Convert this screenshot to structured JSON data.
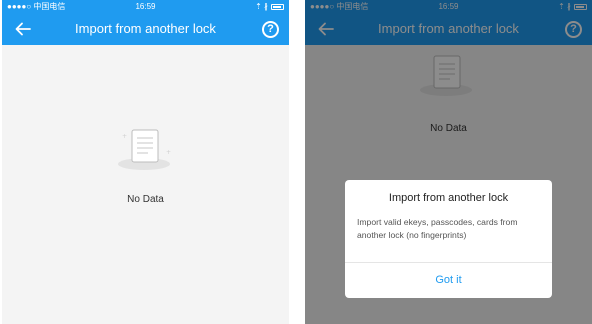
{
  "status_bar": {
    "carrier": "●●●●○ 中国电信 ",
    "time": "16:59",
    "indicators": "⇡ ∦"
  },
  "navbar": {
    "title": "Import from another lock",
    "help_symbol": "?"
  },
  "empty_state": {
    "label": "No Data"
  },
  "dialog": {
    "title": "Import from another lock",
    "message": "Import valid ekeys, passcodes, cards from another lock (no fingerprints)",
    "confirm_label": "Got it"
  },
  "colors": {
    "accent": "#1f9bf0",
    "background": "#f4f4f4",
    "overlay": "rgba(0,0,0,0.45)"
  }
}
